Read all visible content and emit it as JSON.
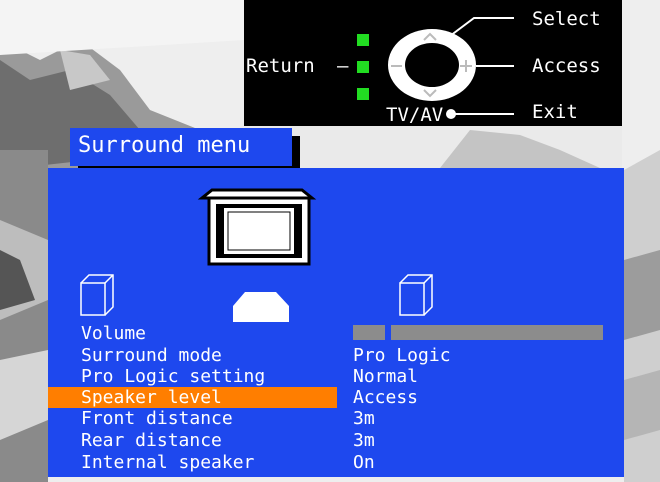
{
  "remote": {
    "select_label": "Select",
    "access_label": "Access",
    "exit_label": "Exit",
    "return_label": "Return",
    "return_dash": "–",
    "tvav_label": "TV/AV"
  },
  "menu": {
    "title": "Surround menu",
    "items": [
      {
        "label": "Volume",
        "value": ""
      },
      {
        "label": "Surround mode",
        "value": "Pro Logic"
      },
      {
        "label": "Pro Logic setting",
        "value": "Normal"
      },
      {
        "label": "Speaker level",
        "value": "Access"
      },
      {
        "label": "Front distance",
        "value": "3m"
      },
      {
        "label": "Rear distance",
        "value": "3m"
      },
      {
        "label": "Internal speaker",
        "value": "On"
      }
    ],
    "selected_index": 3
  },
  "colors": {
    "panel": "#1e48ee",
    "highlight": "#ff7e00",
    "remote_bg": "#000000",
    "indicator": "#22dd22"
  }
}
